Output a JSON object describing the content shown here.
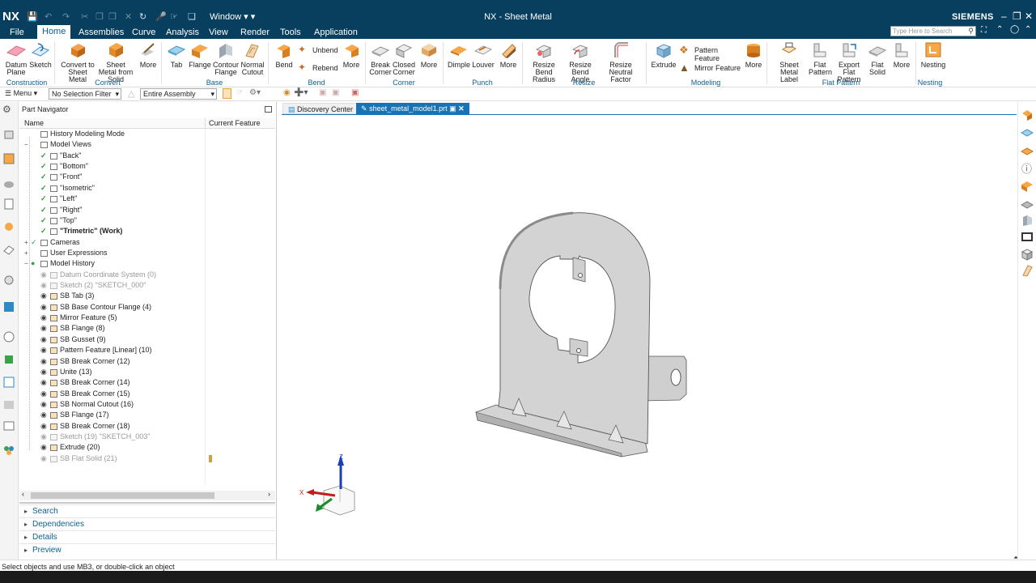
{
  "app": {
    "logo": "NX",
    "window_title": "NX - Sheet Metal",
    "window_menu": "Window",
    "brand": "SIEMENS",
    "search_placeholder": "Type Here to Search"
  },
  "menu_tabs": [
    "File",
    "Home",
    "Assemblies",
    "Curve",
    "Analysis",
    "View",
    "Render",
    "Tools",
    "Application"
  ],
  "active_tab": "Home",
  "ribbon": {
    "groups": [
      {
        "label": "Construction"
      },
      {
        "label": "Convert"
      },
      {
        "label": "Base"
      },
      {
        "label": "Bend"
      },
      {
        "label": "Corner"
      },
      {
        "label": "Punch"
      },
      {
        "label": "Resize"
      },
      {
        "label": "Modeling"
      },
      {
        "label": "Flat Pattern"
      },
      {
        "label": "Nesting"
      }
    ],
    "buttons": {
      "datum_plane": "Datum Plane",
      "sketch": "Sketch",
      "convert_to_sm": "Convert to Sheet Metal",
      "sm_from_solid": "Sheet Metal from Solid",
      "more1": "More",
      "tab": "Tab",
      "flange": "Flange",
      "contour_flange": "Contour Flange",
      "normal_cutout": "Normal Cutout",
      "bend": "Bend",
      "unbend": "Unbend",
      "rebend": "Rebend",
      "more2": "More",
      "break_corner": "Break Corner",
      "closed_corner": "Closed Corner",
      "more3": "More",
      "dimple": "Dimple",
      "louver": "Louver",
      "more4": "More",
      "resize_bend_radius": "Resize Bend Radius",
      "resize_bend_angle": "Resize Bend Angle",
      "resize_neutral_factor": "Resize Neutral Factor",
      "extrude": "Extrude",
      "pattern_feature": "Pattern Feature",
      "mirror_feature": "Mirror Feature",
      "more5": "More",
      "sheet_metal_label": "Sheet Metal Label",
      "flat_pattern": "Flat Pattern",
      "export_flat_pattern": "Export Flat Pattern",
      "flat_solid": "Flat Solid",
      "more6": "More",
      "nesting": "Nesting"
    }
  },
  "toolbar": {
    "menu": "Menu",
    "selection_filter": "No Selection Filter",
    "scope": "Entire Assembly"
  },
  "navigator": {
    "title": "Part Navigator",
    "col_name": "Name",
    "col_feature": "Current Feature",
    "rows": [
      {
        "label": "History Modeling Mode",
        "indent": 0,
        "style": ""
      },
      {
        "label": "Model Views",
        "indent": 0,
        "style": ""
      },
      {
        "label": "\"Back\"",
        "indent": 1,
        "style": ""
      },
      {
        "label": "\"Bottom\"",
        "indent": 1,
        "style": ""
      },
      {
        "label": "\"Front\"",
        "indent": 1,
        "style": ""
      },
      {
        "label": "\"Isometric\"",
        "indent": 1,
        "style": ""
      },
      {
        "label": "\"Left\"",
        "indent": 1,
        "style": ""
      },
      {
        "label": "\"Right\"",
        "indent": 1,
        "style": ""
      },
      {
        "label": "\"Top\"",
        "indent": 1,
        "style": ""
      },
      {
        "label": "\"Trimetric\" (Work)",
        "indent": 1,
        "style": "bold"
      },
      {
        "label": "Cameras",
        "indent": 0,
        "style": ""
      },
      {
        "label": "User Expressions",
        "indent": 0,
        "style": ""
      },
      {
        "label": "Model History",
        "indent": 0,
        "style": ""
      },
      {
        "label": "Datum Coordinate System (0)",
        "indent": 1,
        "style": "dim"
      },
      {
        "label": "Sketch (2) \"SKETCH_000\"",
        "indent": 1,
        "style": "dim"
      },
      {
        "label": "SB Tab (3)",
        "indent": 1,
        "style": ""
      },
      {
        "label": "SB Base Contour Flange (4)",
        "indent": 1,
        "style": ""
      },
      {
        "label": "Mirror Feature (5)",
        "indent": 1,
        "style": ""
      },
      {
        "label": "SB Flange (8)",
        "indent": 1,
        "style": ""
      },
      {
        "label": "SB Gusset (9)",
        "indent": 1,
        "style": ""
      },
      {
        "label": "Pattern Feature [Linear] (10)",
        "indent": 1,
        "style": ""
      },
      {
        "label": "SB Break Corner (12)",
        "indent": 1,
        "style": ""
      },
      {
        "label": "Unite (13)",
        "indent": 1,
        "style": ""
      },
      {
        "label": "SB Break Corner (14)",
        "indent": 1,
        "style": ""
      },
      {
        "label": "SB Break Corner (15)",
        "indent": 1,
        "style": ""
      },
      {
        "label": "SB Normal Cutout (16)",
        "indent": 1,
        "style": ""
      },
      {
        "label": "SB Flange (17)",
        "indent": 1,
        "style": ""
      },
      {
        "label": "SB Break Corner (18)",
        "indent": 1,
        "style": ""
      },
      {
        "label": "Sketch (19) \"SKETCH_003\"",
        "indent": 1,
        "style": "dim"
      },
      {
        "label": "Extrude (20)",
        "indent": 1,
        "style": ""
      },
      {
        "label": "SB Flat Solid (21)",
        "indent": 1,
        "style": "dim"
      }
    ],
    "panels": [
      "Search",
      "Dependencies",
      "Details",
      "Preview"
    ]
  },
  "tabs": [
    "Discovery Center",
    "sheet_metal_model1.prt"
  ],
  "triad": {
    "x": "X",
    "z": "Z"
  },
  "status": "Select objects and use MB3, or double-click an object",
  "colors": {
    "title_bg": "#083f5e",
    "accent": "#0c5f8f",
    "part": "#cfcfcf",
    "part_dark": "#a9a9a9"
  }
}
